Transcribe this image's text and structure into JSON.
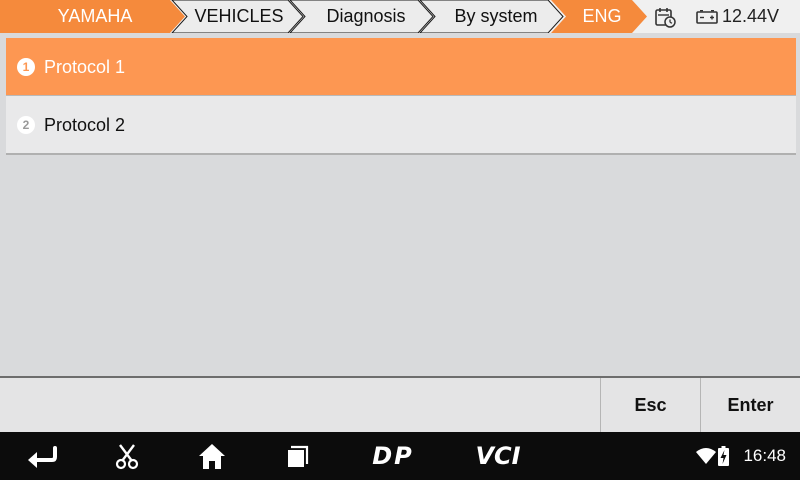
{
  "breadcrumb": {
    "items": [
      {
        "label": "YAMAHA",
        "active": true
      },
      {
        "label": "VEHICLES",
        "active": false
      },
      {
        "label": "Diagnosis",
        "active": false
      },
      {
        "label": "By system",
        "active": false
      },
      {
        "label": "ENG",
        "active": true
      }
    ]
  },
  "status": {
    "voltage": "12.44V",
    "icons": [
      "calendar-clock-icon",
      "battery-icon"
    ]
  },
  "list": {
    "items": [
      {
        "number": "1",
        "label": "Protocol 1",
        "selected": true
      },
      {
        "number": "2",
        "label": "Protocol 2",
        "selected": false
      }
    ]
  },
  "buttons": {
    "esc_label": "Esc",
    "enter_label": "Enter"
  },
  "navbar": {
    "icons": [
      "back-icon",
      "scissors-icon",
      "home-icon",
      "recents-icon",
      "dp-icon",
      "vci-icon"
    ],
    "dp_label": "DP",
    "vci_label": "VCI",
    "time": "16:48",
    "status_icons": [
      "wifi-icon",
      "battery-charging-icon"
    ]
  },
  "colors": {
    "accent": "#fd9752",
    "breadcrumb_accent": "#f58a3c",
    "header_bg": "#f0f0f0",
    "body_bg": "#d9dadc",
    "navbar_bg": "#0c0c0c"
  }
}
